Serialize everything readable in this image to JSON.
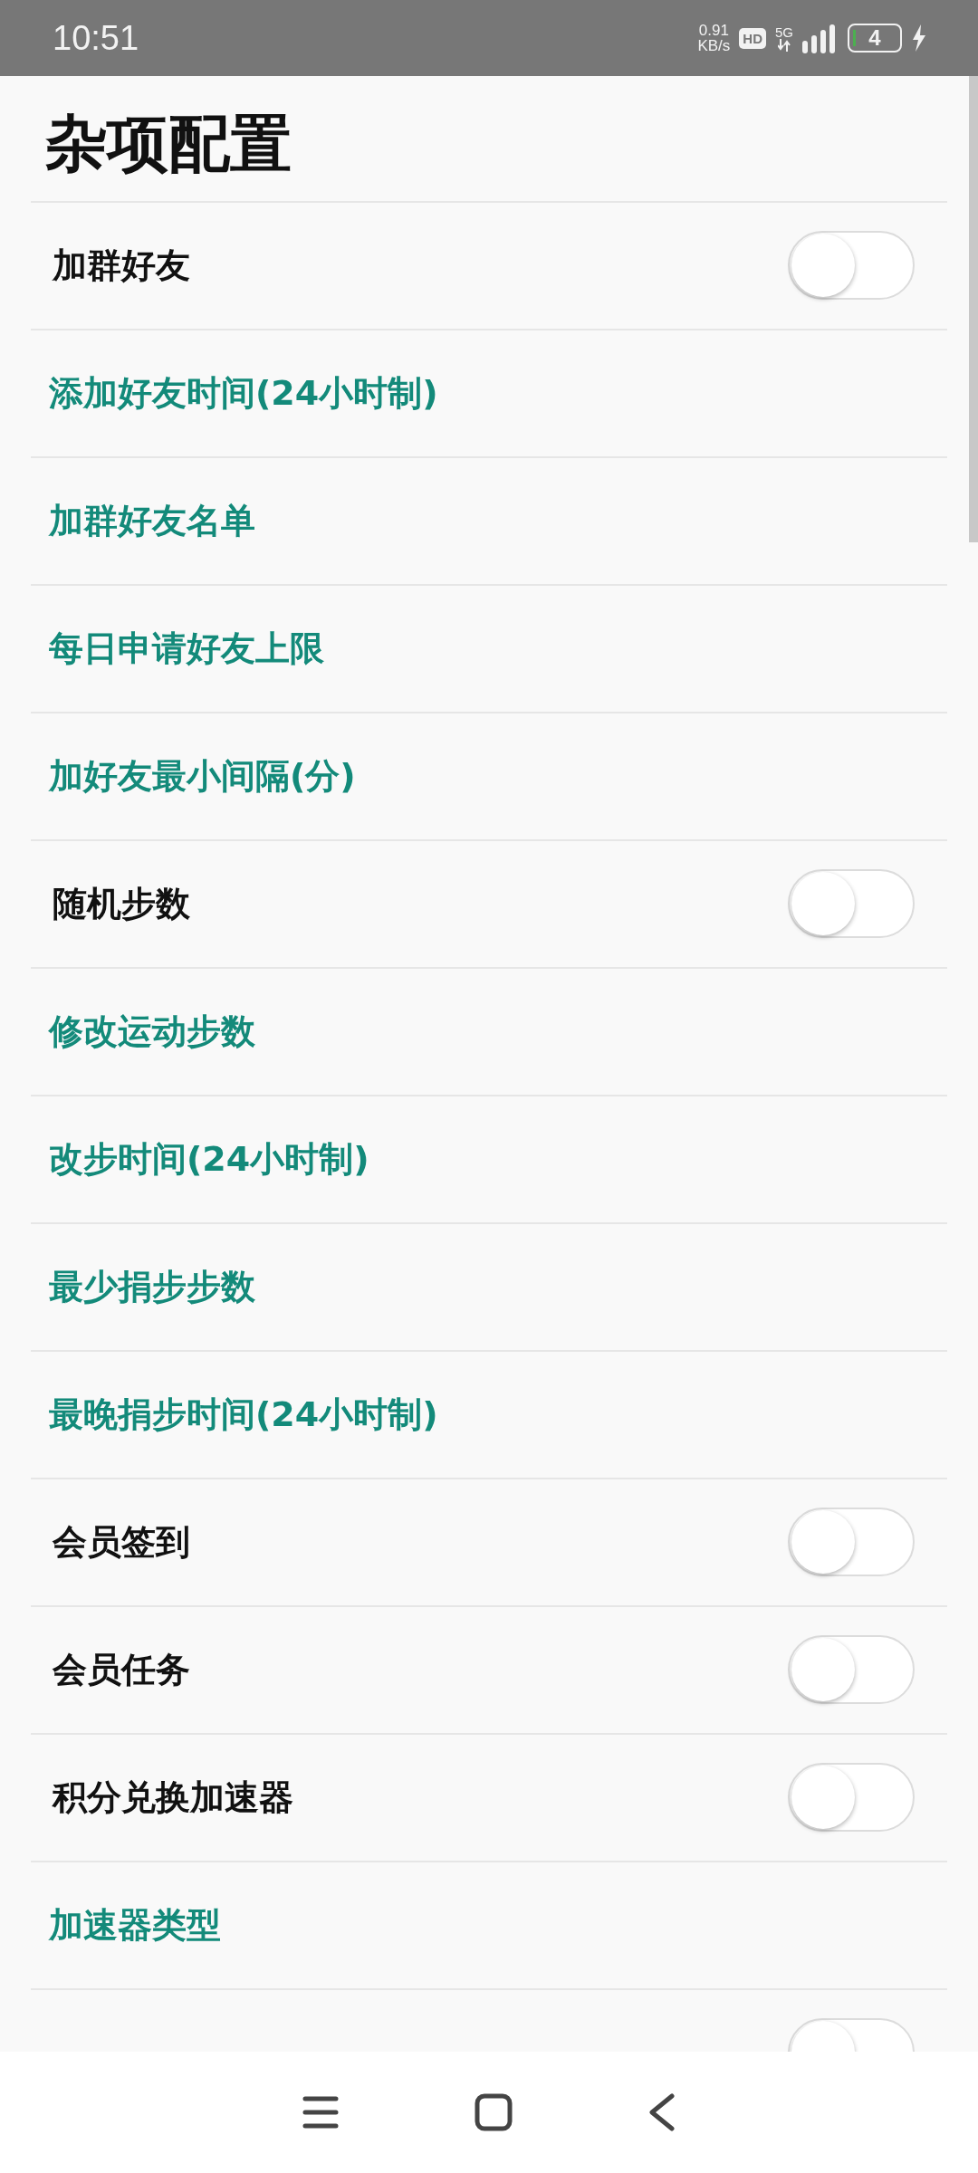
{
  "status_bar": {
    "time": "10:51",
    "speed_value": "0.91",
    "speed_unit": "KB/s",
    "hd_badge": "HD",
    "network": "5G",
    "battery": "4"
  },
  "title": "杂项配置",
  "items": [
    {
      "kind": "switch",
      "label": "加群好友",
      "on": false
    },
    {
      "kind": "link",
      "label": "添加好友时间(24小时制)"
    },
    {
      "kind": "link",
      "label": "加群好友名单"
    },
    {
      "kind": "link",
      "label": "每日申请好友上限"
    },
    {
      "kind": "link",
      "label": "加好友最小间隔(分)"
    },
    {
      "kind": "switch",
      "label": "随机步数",
      "on": false
    },
    {
      "kind": "link",
      "label": "修改运动步数"
    },
    {
      "kind": "link",
      "label": "改步时间(24小时制)"
    },
    {
      "kind": "link",
      "label": "最少捐步步数"
    },
    {
      "kind": "link",
      "label": "最晚捐步时间(24小时制)"
    },
    {
      "kind": "switch",
      "label": "会员签到",
      "on": false
    },
    {
      "kind": "switch",
      "label": "会员任务",
      "on": false
    },
    {
      "kind": "switch",
      "label": "积分兑换加速器",
      "on": false
    },
    {
      "kind": "link",
      "label": "加速器类型"
    },
    {
      "kind": "switch",
      "on": false
    }
  ]
}
